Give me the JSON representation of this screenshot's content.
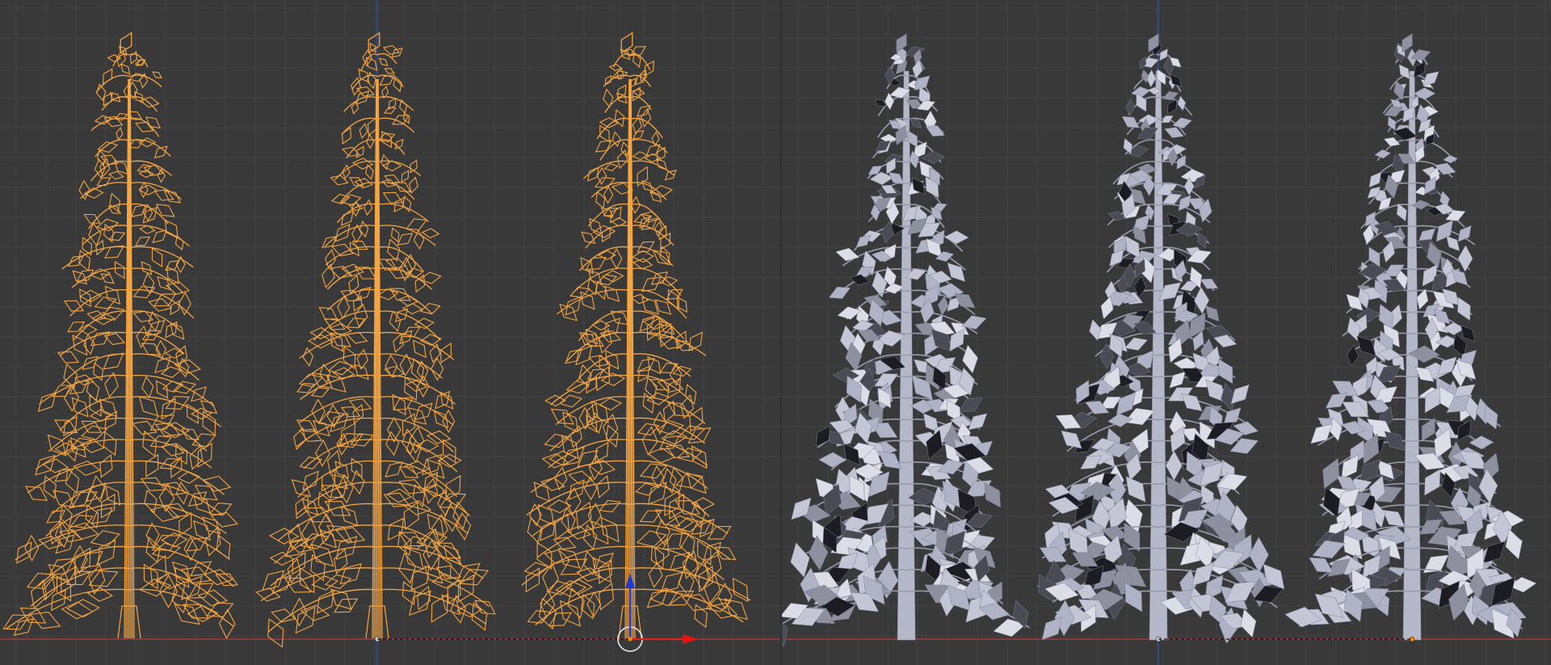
{
  "scene": {
    "left_viewport": {
      "shading_mode": "wireframe",
      "objects": [
        "tree-wireframe-1",
        "tree-wireframe-2",
        "tree-wireframe-3"
      ],
      "wire_color": "#f5a542",
      "background_color": "#393939",
      "grid_color": "#424242",
      "active_object": "tree-wireframe-3",
      "transform_manipulator": true
    },
    "right_viewport": {
      "shading_mode": "solid",
      "objects": [
        "tree-solid-1",
        "tree-solid-2",
        "tree-solid-3"
      ],
      "mesh_color": "#b9bcd0",
      "background_color": "#393939",
      "grid_color": "#424242"
    },
    "axis_colors": {
      "x_axis": "#a33a3a",
      "y_axis": "#2f4f9a",
      "z_axis": "#1d3ad6",
      "pivot": "#ff8a00"
    }
  }
}
